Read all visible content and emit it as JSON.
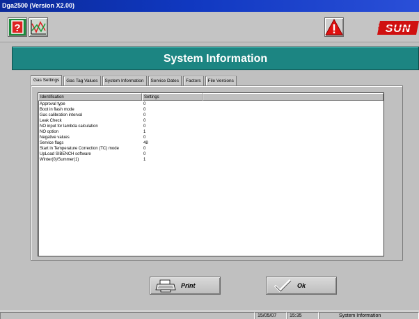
{
  "window": {
    "title": "Dga2500 (Version X2.00)"
  },
  "toolbar": {
    "help_icon": "help-question-icon",
    "graph_icon": "graph-icon",
    "warning_icon": "warning-triangle-icon",
    "logo_text": "SUN"
  },
  "header": {
    "title": "System Information",
    "color": "#1c8582"
  },
  "tabs": [
    {
      "label": "Gas Settings",
      "active": true
    },
    {
      "label": "Gas Tag Values",
      "active": false
    },
    {
      "label": "System Information",
      "active": false
    },
    {
      "label": "Service Dates",
      "active": false
    },
    {
      "label": "Factors",
      "active": false
    },
    {
      "label": "File Versions",
      "active": false
    }
  ],
  "list": {
    "columns": [
      "Identification",
      "Settings",
      ""
    ],
    "rows": [
      {
        "ident": "Approval type",
        "value": "0"
      },
      {
        "ident": "Boot in flash mode",
        "value": "0"
      },
      {
        "ident": "Gas calibration interval",
        "value": "0"
      },
      {
        "ident": "Leak Check",
        "value": "0"
      },
      {
        "ident": "NO input for lambda calculation",
        "value": "0"
      },
      {
        "ident": "NO option",
        "value": "1"
      },
      {
        "ident": "Negative values",
        "value": "0"
      },
      {
        "ident": "Service flags",
        "value": "48"
      },
      {
        "ident": "Start in Temperature Correction (TC) mode",
        "value": "0"
      },
      {
        "ident": "UpLoad SIBENCH software",
        "value": "0"
      },
      {
        "ident": "Winter(0)/Summer(1)",
        "value": "1"
      }
    ]
  },
  "buttons": {
    "print_label": "Print",
    "ok_label": "Ok",
    "print_icon": "printer-icon",
    "ok_icon": "checkmark-icon"
  },
  "statusbar": {
    "date": "15/05/07",
    "time": "15:35",
    "section": "System Information"
  }
}
